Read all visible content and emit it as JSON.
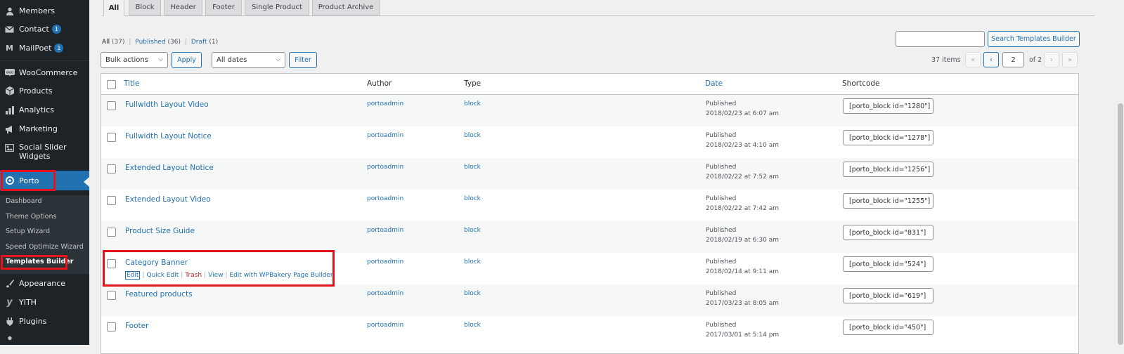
{
  "sidebar": {
    "members": "Members",
    "contact": "Contact",
    "contact_badge": "1",
    "mailpoet": "MailPoet",
    "mailpoet_badge": "1",
    "woocommerce": "WooCommerce",
    "products": "Products",
    "analytics": "Analytics",
    "marketing": "Marketing",
    "social_slider_1": "Social Slider",
    "social_slider_2": "Widgets",
    "porto": "Porto",
    "submenu": {
      "dashboard": "Dashboard",
      "theme_options": "Theme Options",
      "setup_wizard": "Setup Wizard",
      "speed_wizard": "Speed Optimize Wizard",
      "templates_builder": "Templates Builder"
    },
    "appearance": "Appearance",
    "yith": "YITH",
    "plugins": "Plugins"
  },
  "tabs": [
    "All",
    "Block",
    "Header",
    "Footer",
    "Single Product",
    "Product Archive"
  ],
  "filters": {
    "all": "All",
    "all_count": "(37)",
    "published": "Published",
    "published_count": "(36)",
    "draft": "Draft",
    "draft_count": "(1)",
    "sep": "|"
  },
  "toolbar": {
    "bulk_actions": "Bulk actions",
    "apply": "Apply",
    "all_dates": "All dates",
    "filter": "Filter",
    "search_button": "Search Templates Builder",
    "search_value": ""
  },
  "pagination": {
    "items": "37 items",
    "first": "«",
    "prev": "‹",
    "current_page": "2",
    "of": "of 2",
    "next": "›",
    "last": "»"
  },
  "table": {
    "headers": {
      "title": "Title",
      "author": "Author",
      "type": "Type",
      "date": "Date",
      "shortcode": "Shortcode"
    },
    "rows": [
      {
        "title": "Fullwidth Layout Video",
        "author": "portoadmin",
        "type": "block",
        "status": "Published",
        "date": "2018/02/23 at 6:07 am",
        "shortcode": "[porto_block id=\"1280\"]"
      },
      {
        "title": "Fullwidth Layout Notice",
        "author": "portoadmin",
        "type": "block",
        "status": "Published",
        "date": "2018/02/23 at 4:10 am",
        "shortcode": "[porto_block id=\"1278\"]"
      },
      {
        "title": "Extended Layout Notice",
        "author": "portoadmin",
        "type": "block",
        "status": "Published",
        "date": "2018/02/22 at 7:52 am",
        "shortcode": "[porto_block id=\"1256\"]"
      },
      {
        "title": "Extended Layout Video",
        "author": "portoadmin",
        "type": "block",
        "status": "Published",
        "date": "2018/02/22 at 7:42 am",
        "shortcode": "[porto_block id=\"1255\"]"
      },
      {
        "title": "Product Size Guide",
        "author": "portoadmin",
        "type": "block",
        "status": "Published",
        "date": "2018/02/19 at 6:30 am",
        "shortcode": "[porto_block id=\"831\"]"
      },
      {
        "title": "Category Banner",
        "author": "portoadmin",
        "type": "block",
        "status": "Published",
        "date": "2018/02/14 at 9:11 am",
        "shortcode": "[porto_block id=\"524\"]"
      },
      {
        "title": "Featured products",
        "author": "portoadmin",
        "type": "block",
        "status": "Published",
        "date": "2017/03/23 at 8:05 am",
        "shortcode": "[porto_block id=\"619\"]"
      },
      {
        "title": "Footer",
        "author": "portoadmin",
        "type": "block",
        "status": "Published",
        "date": "2017/03/01 at 5:14 pm",
        "shortcode": "[porto_block id=\"450\"]"
      }
    ],
    "row_actions": {
      "edit": "Edit",
      "quick_edit": "Quick Edit",
      "trash": "Trash",
      "view": "View",
      "edit_wpbakery": "Edit with WPBakery Page Builder",
      "sep": "|"
    }
  },
  "colors": {
    "accent": "#2271b1",
    "sidebar_bg": "#1d2327",
    "highlight": "#e3121b",
    "trash": "#b32d2e"
  }
}
